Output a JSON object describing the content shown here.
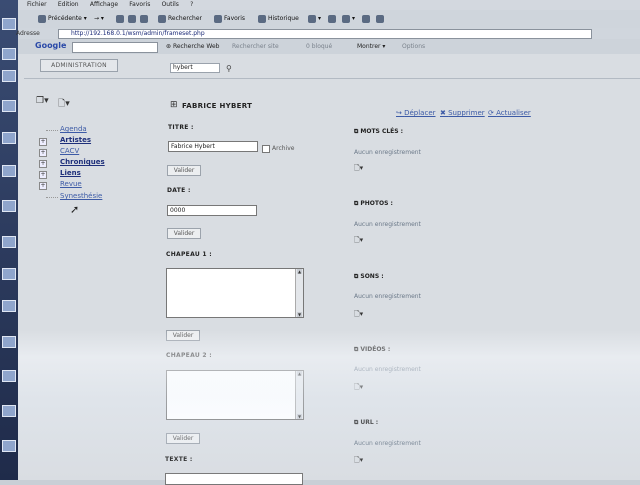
{
  "browser": {
    "menu": [
      "Fichier",
      "Edition",
      "Affichage",
      "Favoris",
      "Outils",
      "?"
    ],
    "toolbar": {
      "back": "Précédente",
      "search": "Rechercher",
      "favorites": "Favoris",
      "history": "Historique"
    },
    "address_label": "Adresse",
    "address_value": "http://192.168.0.1/wsm/admin/frameset.php",
    "google": {
      "logo": "Google",
      "search_web": "Recherche Web",
      "search_site": "Rechercher site",
      "blocked": "0 bloqué",
      "show": "Montrer",
      "options": "Options"
    }
  },
  "page": {
    "admin_button": "ADMINISTRATION",
    "search_value": "hybert",
    "nav_items": [
      {
        "label": "Agenda",
        "bold": false,
        "expand": ""
      },
      {
        "label": "Artistes",
        "bold": true,
        "expand": "+"
      },
      {
        "label": "CACV",
        "bold": false,
        "expand": "+"
      },
      {
        "label": "Chroniques",
        "bold": true,
        "expand": "+"
      },
      {
        "label": "Liens",
        "bold": true,
        "expand": "+"
      },
      {
        "label": "Revue",
        "bold": false,
        "expand": "+"
      },
      {
        "label": "Synesthésie",
        "bold": false,
        "expand": ""
      }
    ],
    "record_title": "FABRICE HYBERT",
    "actions": {
      "move": "Déplacer",
      "delete": "Supprimer",
      "refresh": "Actualiser"
    },
    "form": {
      "titre_label": "TITRE :",
      "titre_value": "Fabrice Hybert",
      "archive_label": "Archive",
      "date_label": "DATE :",
      "date_value": "0000",
      "chapeau1_label": "CHAPEAU 1 :",
      "chapeau2_label": "CHAPEAU 2 :",
      "texte_label": "TEXTE :",
      "valider": "Valider"
    },
    "sections": [
      {
        "title": "MOTS CLÉS :",
        "empty": "Aucun enregistrement"
      },
      {
        "title": "PHOTOS :",
        "empty": "Aucun enregistrement"
      },
      {
        "title": "SONS :",
        "empty": "Aucun enregistrement"
      },
      {
        "title": "VIDÉOS :",
        "empty": "Aucun enregistrement"
      },
      {
        "title": "URL :",
        "empty": "Aucun enregistrement"
      }
    ]
  }
}
